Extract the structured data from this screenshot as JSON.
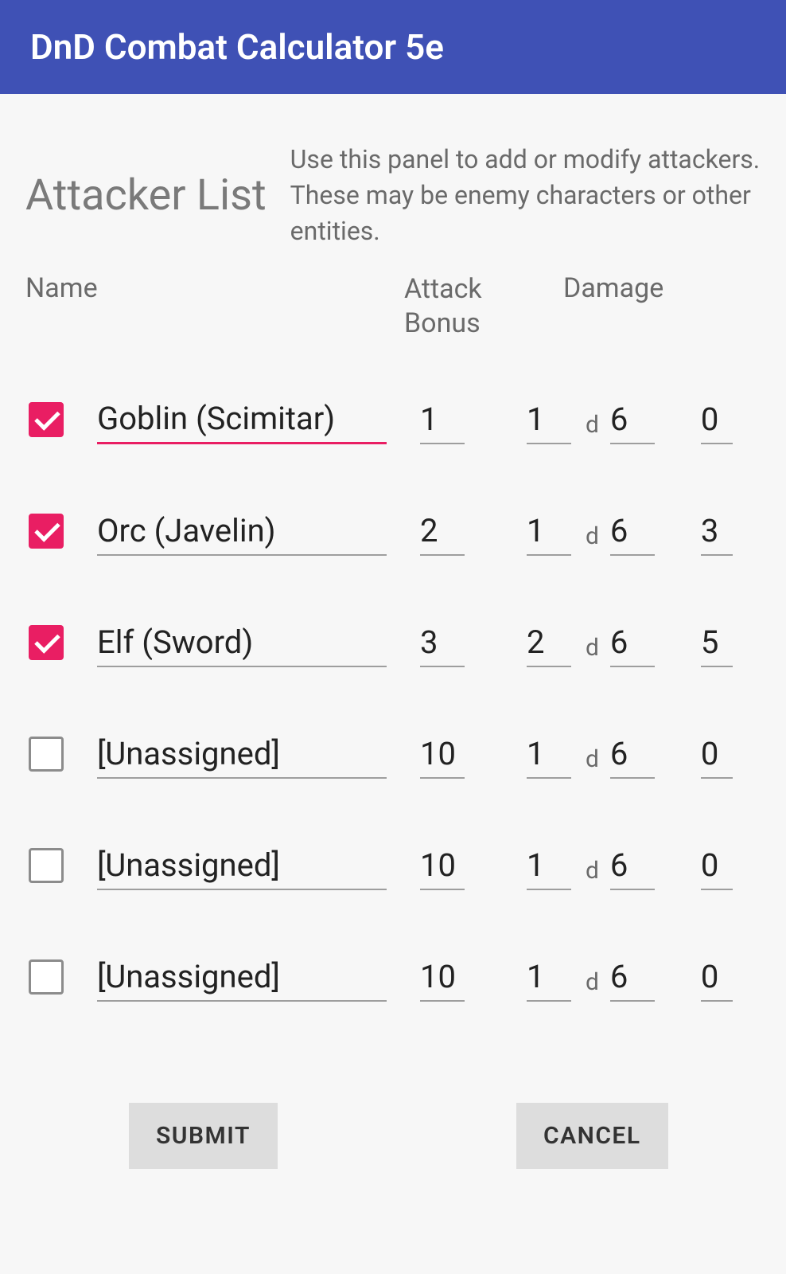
{
  "header": {
    "title": "DnD Combat Calculator 5e"
  },
  "section": {
    "title": "Attacker List",
    "description": "Use this panel to add or modify attackers. These may be enemy characters or other entities."
  },
  "columns": {
    "name": "Name",
    "attack": "Attack Bonus",
    "damage": "Damage"
  },
  "rows": [
    {
      "checked": true,
      "active": true,
      "name": "Goblin (Scimitar)",
      "attack": "1",
      "diceCount": "1",
      "diceSides": "6",
      "extra": "0"
    },
    {
      "checked": true,
      "active": false,
      "name": "Orc (Javelin)",
      "attack": "2",
      "diceCount": "1",
      "diceSides": "6",
      "extra": "3"
    },
    {
      "checked": true,
      "active": false,
      "name": "Elf (Sword)",
      "attack": "3",
      "diceCount": "2",
      "diceSides": "6",
      "extra": "5"
    },
    {
      "checked": false,
      "active": false,
      "name": "[Unassigned]",
      "attack": "10",
      "diceCount": "1",
      "diceSides": "6",
      "extra": "0"
    },
    {
      "checked": false,
      "active": false,
      "name": "[Unassigned]",
      "attack": "10",
      "diceCount": "1",
      "diceSides": "6",
      "extra": "0"
    },
    {
      "checked": false,
      "active": false,
      "name": "[Unassigned]",
      "attack": "10",
      "diceCount": "1",
      "diceSides": "6",
      "extra": "0"
    }
  ],
  "dSeparator": "d",
  "buttons": {
    "submit": "SUBMIT",
    "cancel": "CANCEL"
  }
}
